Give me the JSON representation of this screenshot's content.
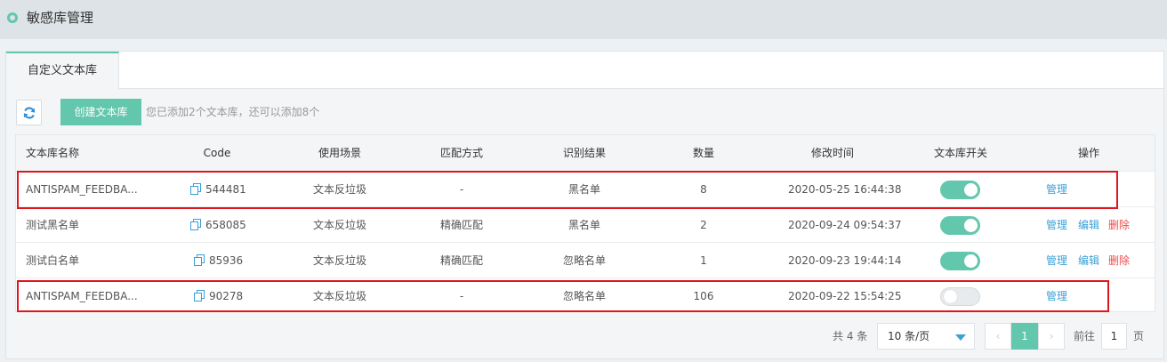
{
  "header": {
    "title": "敏感库管理"
  },
  "tabs": [
    {
      "label": "自定义文本库"
    }
  ],
  "toolbar": {
    "create_label": "创建文本库",
    "hint": "您已添加2个文本库，还可以添加8个"
  },
  "table": {
    "columns": [
      "文本库名称",
      "Code",
      "使用场景",
      "匹配方式",
      "识别结果",
      "数量",
      "修改时间",
      "文本库开关",
      "操作"
    ],
    "rows": [
      {
        "name": "ANTISPAM_FEEDBA...",
        "code": "544481",
        "scene": "文本反垃圾",
        "match": "-",
        "result": "黑名单",
        "count": "8",
        "time": "2020-05-25 16:44:38",
        "switch_on": true,
        "actions": [
          "管理"
        ]
      },
      {
        "name": "测试黑名单",
        "code": "658085",
        "scene": "文本反垃圾",
        "match": "精确匹配",
        "result": "黑名单",
        "count": "2",
        "time": "2020-09-24 09:54:37",
        "switch_on": true,
        "actions": [
          "管理",
          "编辑",
          "删除"
        ]
      },
      {
        "name": "测试白名单",
        "code": "85936",
        "scene": "文本反垃圾",
        "match": "精确匹配",
        "result": "忽略名单",
        "count": "1",
        "time": "2020-09-23 19:44:14",
        "switch_on": true,
        "actions": [
          "管理",
          "编辑",
          "删除"
        ]
      },
      {
        "name": "ANTISPAM_FEEDBA...",
        "code": "90278",
        "scene": "文本反垃圾",
        "match": "-",
        "result": "忽略名单",
        "count": "106",
        "time": "2020-09-22 15:54:25",
        "switch_on": false,
        "actions": [
          "管理"
        ]
      }
    ]
  },
  "pager": {
    "total": "共 4 条",
    "page_size": "10 条/页",
    "prev": "‹",
    "current": "1",
    "next": "›",
    "goto_prefix": "前往",
    "goto_value": "1",
    "goto_suffix": "页"
  },
  "colors": {
    "accent": "#62c7ad",
    "link": "#3aa0d6",
    "danger": "#f04b4b",
    "highlight": "#e0161d"
  },
  "icons": {
    "refresh": "refresh-icon",
    "copy": "copy-icon",
    "dropdown": "caret-down-icon"
  }
}
